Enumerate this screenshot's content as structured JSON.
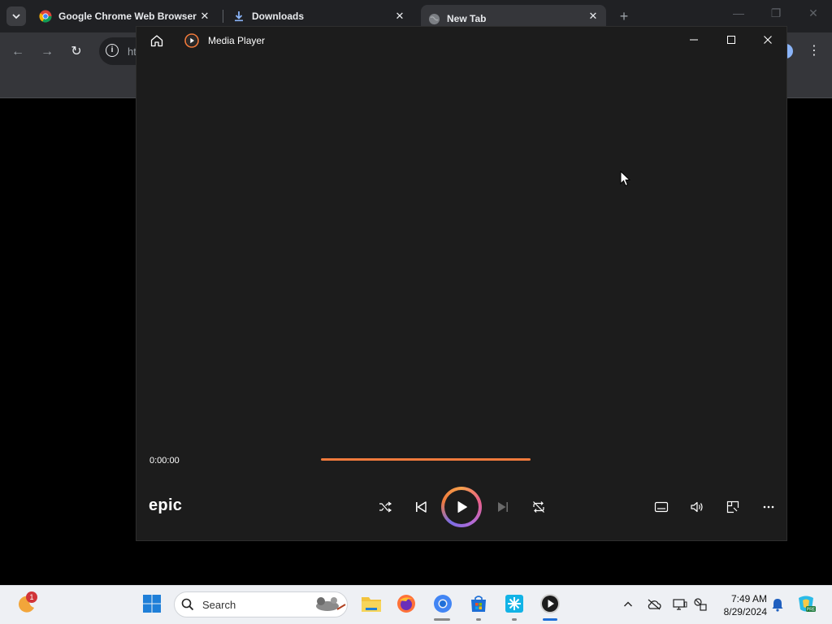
{
  "browser": {
    "tabs": [
      {
        "label": "Google Chrome Web Browser",
        "icon": "chrome-icon"
      },
      {
        "label": "Downloads",
        "icon": "download-icon"
      },
      {
        "label": "New Tab",
        "icon": "globe-icon"
      }
    ],
    "omnibox_text": "ht"
  },
  "media_player": {
    "title": "Media Player",
    "time": "0:00:00",
    "brand": "epic",
    "progress": 0.0,
    "accent": "#f07a3c"
  },
  "taskbar": {
    "search_placeholder": "Search",
    "notification_count": "1",
    "clock_time": "7:49 AM",
    "clock_date": "8/29/2024"
  }
}
